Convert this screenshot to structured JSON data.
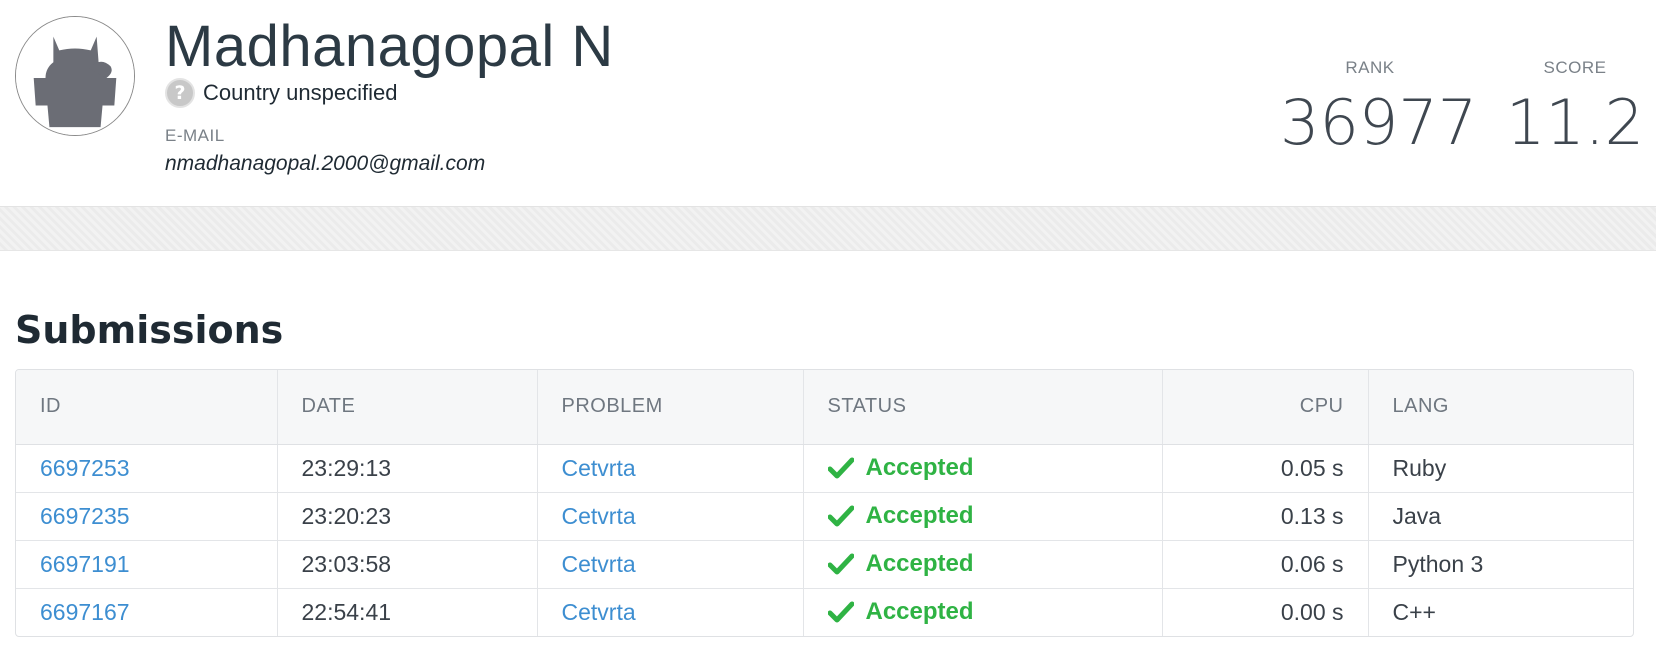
{
  "profile": {
    "name": "Madhanagopal N",
    "country": "Country unspecified",
    "email_label": "E-MAIL",
    "email": "nmadhanagopal.2000@gmail.com",
    "avatar_icon": "cat-avatar-icon",
    "country_icon": "question-mark-icon"
  },
  "stats": {
    "rank_label": "RANK",
    "rank_value": "36977",
    "score_label": "SCORE",
    "score_value": "11.2"
  },
  "submissions": {
    "title": "Submissions",
    "columns": [
      "ID",
      "DATE",
      "PROBLEM",
      "STATUS",
      "CPU",
      "LANG"
    ],
    "rows": [
      {
        "id": "6697253",
        "date": "23:29:13",
        "problem": "Cetvrta",
        "status": "Accepted",
        "cpu": "0.05 s",
        "lang": "Ruby"
      },
      {
        "id": "6697235",
        "date": "23:20:23",
        "problem": "Cetvrta",
        "status": "Accepted",
        "cpu": "0.13 s",
        "lang": "Java"
      },
      {
        "id": "6697191",
        "date": "23:03:58",
        "problem": "Cetvrta",
        "status": "Accepted",
        "cpu": "0.06 s",
        "lang": "Python 3"
      },
      {
        "id": "6697167",
        "date": "22:54:41",
        "problem": "Cetvrta",
        "status": "Accepted",
        "cpu": "0.00 s",
        "lang": "C++"
      }
    ]
  },
  "colors": {
    "accent_link": "#3d8ed1",
    "accepted": "#2fb344",
    "text_dark": "#2c3a44"
  }
}
